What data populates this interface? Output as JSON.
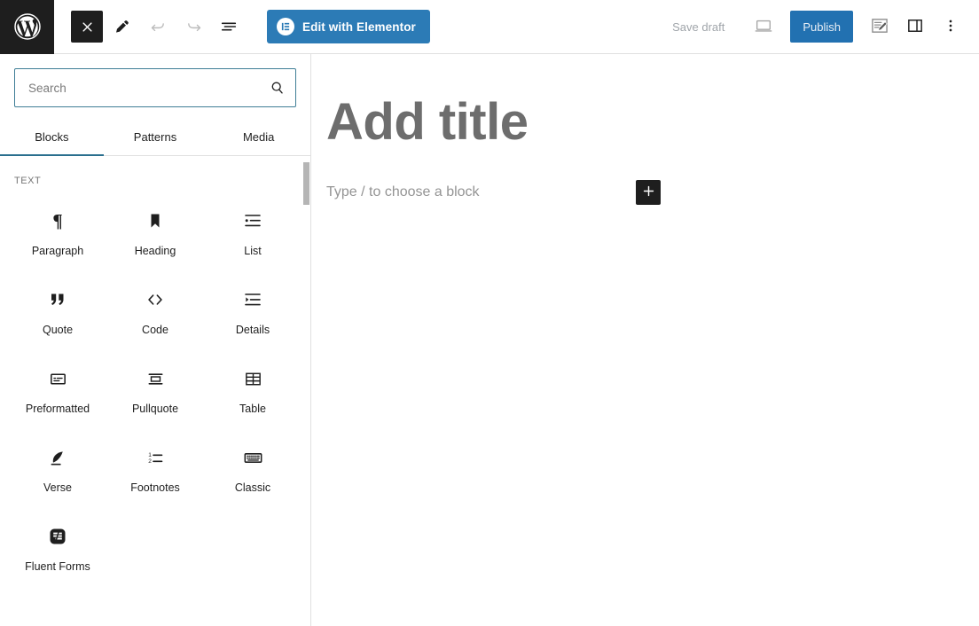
{
  "topbar": {
    "wp_logo_name": "wordpress-logo",
    "close_label": "Close",
    "tools": [
      {
        "name": "close-inserter-button",
        "icon": "close-x-icon",
        "label": "Toggle block inserter",
        "state": "active"
      },
      {
        "name": "edit-tools-button",
        "icon": "pencil-icon",
        "label": "Tools",
        "state": "default"
      },
      {
        "name": "undo-button",
        "icon": "undo-arrow-icon",
        "label": "Undo",
        "state": "disabled"
      },
      {
        "name": "redo-button",
        "icon": "redo-arrow-icon",
        "label": "Redo",
        "state": "disabled"
      },
      {
        "name": "document-overview-button",
        "icon": "list-view-icon",
        "label": "Document Overview",
        "state": "default"
      }
    ],
    "elementor_button_label": "Edit with Elementor",
    "elementor_icon": "elementor-e-icon",
    "save_draft_label": "Save draft",
    "preview_icon": "desktop-preview-icon",
    "preview_label": "Preview",
    "publish_label": "Publish",
    "settings_icon": "post-settings-pencil-icon",
    "settings_label": "Settings",
    "sidebar_icon": "sidebar-panel-icon",
    "sidebar_label": "Sidebar",
    "options_icon": "three-dots-vertical-icon",
    "options_label": "Options"
  },
  "inserter": {
    "search": {
      "placeholder": "Search",
      "value": "",
      "icon": "search-magnifier-icon"
    },
    "tabs": [
      {
        "label": "Blocks",
        "active": true
      },
      {
        "label": "Patterns",
        "active": false
      },
      {
        "label": "Media",
        "active": false
      }
    ],
    "section_label": "TEXT",
    "blocks": [
      {
        "label": "Paragraph",
        "icon": "paragraph-pilcrow-icon"
      },
      {
        "label": "Heading",
        "icon": "heading-bookmark-icon"
      },
      {
        "label": "List",
        "icon": "bulleted-list-icon"
      },
      {
        "label": "Quote",
        "icon": "quotation-marks-icon"
      },
      {
        "label": "Code",
        "icon": "angle-brackets-code-icon"
      },
      {
        "label": "Details",
        "icon": "details-disclosure-icon"
      },
      {
        "label": "Preformatted",
        "icon": "preformatted-box-icon"
      },
      {
        "label": "Pullquote",
        "icon": "pullquote-lines-icon"
      },
      {
        "label": "Table",
        "icon": "table-grid-icon"
      },
      {
        "label": "Verse",
        "icon": "verse-quill-icon"
      },
      {
        "label": "Footnotes",
        "icon": "numbered-list-icon"
      },
      {
        "label": "Classic",
        "icon": "keyboard-classic-icon"
      },
      {
        "label": "Fluent Forms",
        "icon": "fluent-forms-icon"
      }
    ]
  },
  "canvas": {
    "title_placeholder": "Add title",
    "block_placeholder": "Type / to choose a block",
    "add_block_icon": "plus-icon",
    "add_block_label": "Add block"
  },
  "colors": {
    "wp_dark": "#1e1e1e",
    "elementor_blue": "#2c7bb6",
    "publish_blue": "#2271b1",
    "tab_underline": "#2a6f8e",
    "search_border": "#3f7e96",
    "placeholder_gray": "#949494",
    "title_gray": "#6d6d6d",
    "disabled_gray": "#a0a5aa"
  }
}
